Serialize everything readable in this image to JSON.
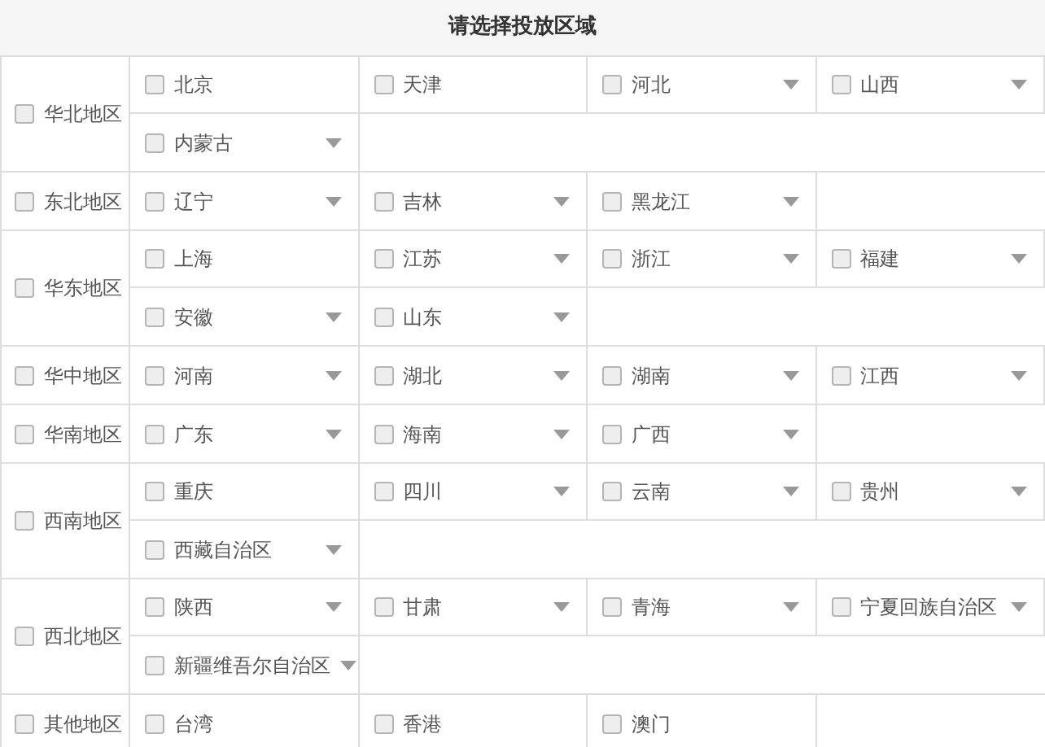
{
  "title": "请选择投放区域",
  "regions": [
    {
      "name": "华北地区",
      "checked": false,
      "provinces": [
        {
          "name": "北京",
          "checked": false,
          "expandable": false
        },
        {
          "name": "天津",
          "checked": false,
          "expandable": false
        },
        {
          "name": "河北",
          "checked": false,
          "expandable": true
        },
        {
          "name": "山西",
          "checked": false,
          "expandable": true
        },
        {
          "name": "内蒙古",
          "checked": false,
          "expandable": true
        }
      ]
    },
    {
      "name": "东北地区",
      "checked": false,
      "provinces": [
        {
          "name": "辽宁",
          "checked": false,
          "expandable": true
        },
        {
          "name": "吉林",
          "checked": false,
          "expandable": true
        },
        {
          "name": "黑龙江",
          "checked": false,
          "expandable": true
        }
      ]
    },
    {
      "name": "华东地区",
      "checked": false,
      "provinces": [
        {
          "name": "上海",
          "checked": false,
          "expandable": false
        },
        {
          "name": "江苏",
          "checked": false,
          "expandable": true
        },
        {
          "name": "浙江",
          "checked": false,
          "expandable": true
        },
        {
          "name": "福建",
          "checked": false,
          "expandable": true
        },
        {
          "name": "安徽",
          "checked": false,
          "expandable": true
        },
        {
          "name": "山东",
          "checked": false,
          "expandable": true
        }
      ]
    },
    {
      "name": "华中地区",
      "checked": false,
      "provinces": [
        {
          "name": "河南",
          "checked": false,
          "expandable": true
        },
        {
          "name": "湖北",
          "checked": false,
          "expandable": true
        },
        {
          "name": "湖南",
          "checked": false,
          "expandable": true
        },
        {
          "name": "江西",
          "checked": false,
          "expandable": true
        }
      ]
    },
    {
      "name": "华南地区",
      "checked": false,
      "provinces": [
        {
          "name": "广东",
          "checked": false,
          "expandable": true
        },
        {
          "name": "海南",
          "checked": false,
          "expandable": true
        },
        {
          "name": "广西",
          "checked": false,
          "expandable": true
        }
      ]
    },
    {
      "name": "西南地区",
      "checked": false,
      "provinces": [
        {
          "name": "重庆",
          "checked": false,
          "expandable": false
        },
        {
          "name": "四川",
          "checked": false,
          "expandable": true
        },
        {
          "name": "云南",
          "checked": false,
          "expandable": true
        },
        {
          "name": "贵州",
          "checked": false,
          "expandable": true
        },
        {
          "name": "西藏自治区",
          "checked": false,
          "expandable": true
        }
      ]
    },
    {
      "name": "西北地区",
      "checked": false,
      "provinces": [
        {
          "name": "陕西",
          "checked": false,
          "expandable": true
        },
        {
          "name": "甘肃",
          "checked": false,
          "expandable": true
        },
        {
          "name": "青海",
          "checked": false,
          "expandable": true
        },
        {
          "name": "宁夏回族自治区",
          "checked": false,
          "expandable": true
        },
        {
          "name": "新疆维吾尔自治区",
          "checked": false,
          "expandable": true
        }
      ]
    },
    {
      "name": "其他地区",
      "checked": false,
      "provinces": [
        {
          "name": "台湾",
          "checked": false,
          "expandable": false
        },
        {
          "name": "香港",
          "checked": false,
          "expandable": false
        },
        {
          "name": "澳门",
          "checked": false,
          "expandable": false
        }
      ]
    }
  ]
}
